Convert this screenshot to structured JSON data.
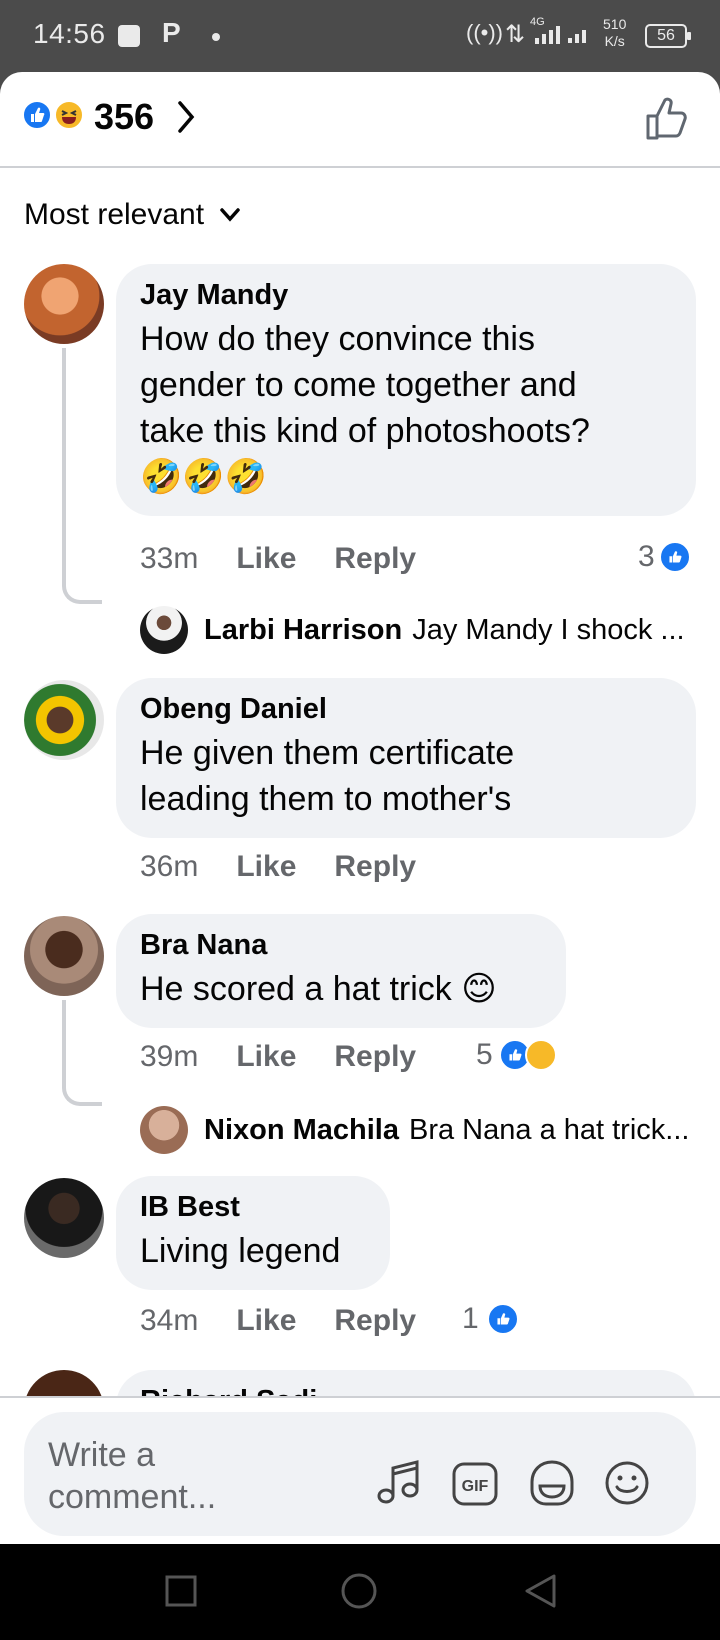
{
  "status_bar": {
    "time": "14:56",
    "app_letter": "P",
    "network": "4G",
    "speed_value": "510",
    "speed_unit": "K/s",
    "battery": "56"
  },
  "header": {
    "reaction_count": "356"
  },
  "sort": {
    "label": "Most relevant"
  },
  "comments": [
    {
      "name": "Jay Mandy",
      "lines": [
        "How do they convince this",
        "gender to come together and",
        "take this kind of photoshoots?"
      ],
      "emoji": "🤣🤣🤣",
      "time": "33m",
      "like": "Like",
      "reply": "Reply",
      "reactions": "3",
      "reply_preview": {
        "name": "Larbi Harrison",
        "text": "Jay Mandy I shock ..."
      }
    },
    {
      "name": "Obeng Daniel",
      "lines": [
        "He given them certificate",
        "leading them to mother's"
      ],
      "time": "36m",
      "like": "Like",
      "reply": "Reply"
    },
    {
      "name": "Bra Nana",
      "lines": [
        "He scored a hat trick 😊"
      ],
      "time": "39m",
      "like": "Like",
      "reply": "Reply",
      "reactions": "5",
      "reply_preview": {
        "name": "Nixon Machila",
        "text": "Bra Nana a hat trick..."
      }
    },
    {
      "name": "IB Best",
      "lines": [
        "Living legend"
      ],
      "time": "34m",
      "like": "Like",
      "reply": "Reply",
      "reactions": "1"
    },
    {
      "name": "Richard Sadi..."
    }
  ],
  "composer": {
    "placeholder": "Write a comment..."
  },
  "icons": {
    "reaction_like": "like-reaction-icon",
    "reaction_haha": "haha-reaction-icon",
    "music": "music-note-icon",
    "gif": "gif-icon",
    "sticker": "sticker-icon",
    "emoji": "emoji-icon"
  },
  "colors": {
    "accent": "#1877f2",
    "bubble": "#f0f2f5",
    "meta": "#65676b",
    "haha": "#f7b928"
  }
}
